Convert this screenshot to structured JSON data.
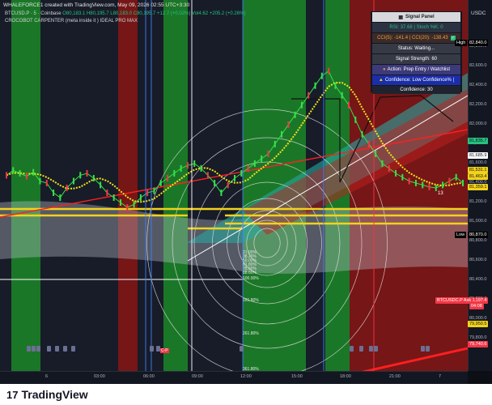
{
  "header": {
    "title": "WHALEFORCE1 created with TradingView.com, May 09, 2026 02:55 UTC+3:30",
    "symbol_line": "BTCUSD.P · 5 · Coinbase",
    "ohlc": "O80,183.1 H80,195.7 L80,183.0 C80,195.7 +12.7 (+0.02%) Vol4.62 +205.2 (+0.26%)",
    "indicator_line": "CROCOBOT CARPENTER (meta inside it ) IDEAL PRO MAX"
  },
  "signal_panel": {
    "title": "Signal Panel",
    "rsi": "RSI: 37.68 | Stoch %K: 0",
    "cci": "CCI(5): -141.4 | CCI(20): -138.43",
    "status": "Status: Waiting...",
    "strength": "Signal Strength: 60",
    "action": "Action: Prep Entry / Watchlist",
    "confidence_label": "Confidence: Low Confidence% |",
    "confidence": "Confidence: 30"
  },
  "chart_data": {
    "type": "line",
    "currency": "USDC",
    "x_ticks": [
      "6",
      "03:00",
      "06:00",
      "09:00",
      "12:00",
      "15:00",
      "18:00",
      "21:00",
      "7"
    ],
    "y_ticks": [
      "82,800.0",
      "82,600.0",
      "82,400.0",
      "82,200.0",
      "82,000.0",
      "81,800.0",
      "81,600.0",
      "81,400.0",
      "81,200.0",
      "81,000.0",
      "80,800.0",
      "80,600.0",
      "80,400.0",
      "80,200.0",
      "80,000.0",
      "79,800.0"
    ],
    "ylim": [
      79620,
      82980
    ],
    "price_series": [
      81480,
      81530,
      81500,
      81470,
      81510,
      81420,
      81400,
      81300,
      81250,
      81350,
      81420,
      81480,
      81500,
      81450,
      81380,
      81300,
      81250,
      81200,
      81150,
      81180,
      81250,
      81300,
      81320,
      81400,
      81450,
      81500,
      81550,
      81580,
      81600,
      81550,
      81480,
      81400,
      81300,
      81380,
      81450,
      81500,
      81550,
      81600,
      81650,
      81700,
      81800,
      81900,
      82000,
      82100,
      82200,
      82300,
      82400,
      82500,
      82550,
      82400,
      82300,
      82200,
      82050,
      81900,
      81800,
      81700,
      81600,
      81550,
      81500,
      81460,
      81420,
      81400,
      81380,
      81360,
      81350,
      81380,
      81420,
      81460,
      81400
    ],
    "price_labels": [
      {
        "text": "82,840.0",
        "color": "#ffffff",
        "bg": "#000000"
      },
      {
        "text": "81,835.7",
        "color": "#111111",
        "bg": "#26c281"
      },
      {
        "text": "81,685.9",
        "color": "#111111",
        "bg": "#ffffff"
      },
      {
        "text": "81,531.1",
        "color": "#111111",
        "bg": "#f2d21b"
      },
      {
        "text": "81,463.4",
        "color": "#111111",
        "bg": "#f2d21b"
      },
      {
        "text": "81,359.1",
        "color": "#111111",
        "bg": "#f2d21b"
      },
      {
        "text": "80,870.0",
        "color": "#ffffff",
        "bg": "#000000"
      },
      {
        "text": "80,197.4",
        "color": "#ffffff",
        "bg": "#f23645"
      },
      {
        "text": "79,950.5",
        "color": "#111111",
        "bg": "#f2d21b"
      },
      {
        "text": "79,740.6",
        "color": "#ffffff",
        "bg": "#f23645"
      }
    ],
    "side_labels": [
      "High",
      "Low",
      "BTCUSDC.P",
      "Ask"
    ],
    "countdown": "04:08",
    "fib_labels": [
      "21.00%",
      "38.20%",
      "50.00%",
      "61.80%",
      "78.60%",
      "88.60%",
      "100.00%",
      "161.80%",
      "261.80%",
      "361.80%"
    ],
    "marker_count": "13"
  },
  "colors": {
    "bull_zone": "#1e8a2c",
    "bear_zone": "#8a1818",
    "neutral_zone": "#1a1f2c",
    "level_yellow": "#f2d21b",
    "trend_red": "#ff1f1f",
    "cloud_teal": "#2aa6a0"
  },
  "footer": {
    "brand": "TradingView"
  }
}
